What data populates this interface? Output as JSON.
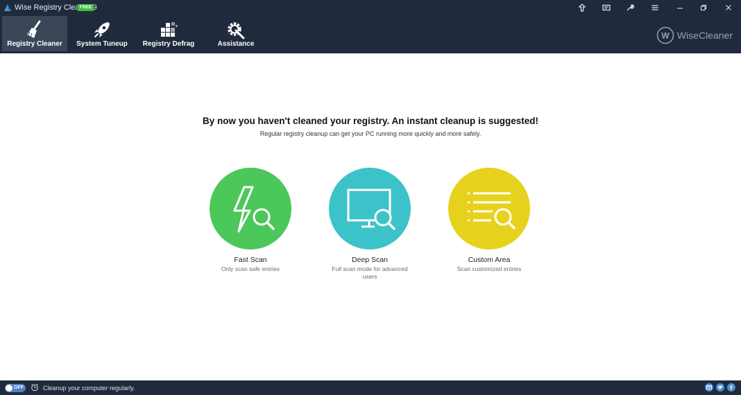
{
  "window": {
    "title": "Wise Registry Cleaner 9",
    "badge": "FREE"
  },
  "titlebar_buttons": [
    {
      "name": "upgrade",
      "icon": "shirt-up-icon"
    },
    {
      "name": "feedback",
      "icon": "message-icon"
    },
    {
      "name": "tools",
      "icon": "wrench-icon"
    },
    {
      "name": "menu",
      "icon": "list-menu-icon"
    },
    {
      "name": "minimize",
      "icon": "minimize-icon"
    },
    {
      "name": "restore",
      "icon": "restore-icon"
    },
    {
      "name": "close",
      "icon": "close-icon"
    }
  ],
  "nav": {
    "tabs": [
      {
        "label": "Registry Cleaner",
        "icon": "broom-icon",
        "active": true
      },
      {
        "label": "System Tuneup",
        "icon": "rocket-icon",
        "active": false
      },
      {
        "label": "Registry Defrag",
        "icon": "blocks-icon",
        "active": false
      },
      {
        "label": "Assistance",
        "icon": "gear-wrench-icon",
        "active": false
      }
    ]
  },
  "brand": {
    "logo_letter": "W",
    "name": "WiseCleaner"
  },
  "main": {
    "headline": "By now you haven't cleaned your registry. An instant cleanup is suggested!",
    "subline": "Regular registry cleanup can get your PC running more quickly and more safely.",
    "options": [
      {
        "title": "Fast Scan",
        "description": "Only scan safe entries",
        "color": "#4cc75a",
        "icon": "lightning-search-icon"
      },
      {
        "title": "Deep Scan",
        "description": "Full scan mode for advanced users",
        "color": "#3cc3c9",
        "icon": "monitor-search-icon"
      },
      {
        "title": "Custom Area",
        "description": "Scan customized entries",
        "color": "#e6d21c",
        "icon": "list-search-icon"
      }
    ]
  },
  "statusbar": {
    "toggle_label": "OFF",
    "message": "Cleanup your computer regularly.",
    "social": [
      "email-icon",
      "twitter-icon",
      "facebook-icon"
    ]
  },
  "colors": {
    "header_bg": "#1f2a3c",
    "active_tab_bg": "#3b4659",
    "badge": "#3fbf3f",
    "toggle": "#4f7fc8",
    "social": "#4a8fd6"
  }
}
